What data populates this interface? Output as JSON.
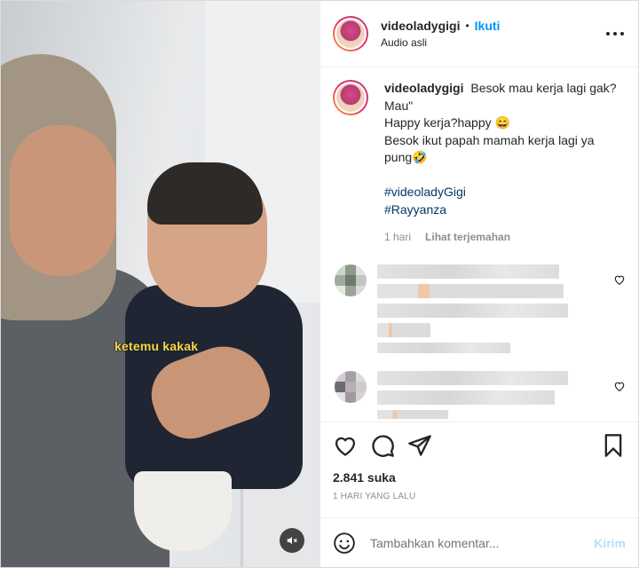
{
  "post": {
    "username": "videoladygigi",
    "separator": "•",
    "follow_label": "Ikuti",
    "audio_label": "Audio asli",
    "more_label": "•••"
  },
  "media": {
    "overlay_caption": "ketemu kakak",
    "sound_icon": "speaker-mute-icon"
  },
  "caption": {
    "username": "videoladygigi",
    "line1": "Besok mau kerja lagi gak? Mau\"",
    "line2": "Happy kerja?happy 😄",
    "line3": "Besok ikut papah mamah kerja lagi ya pung🤣",
    "hashtag1": "#videoladyGigi",
    "hashtag2": "#Rayyanza",
    "time": "1 hari",
    "translate": "Lihat terjemahan"
  },
  "actions": {
    "likes": "2.841 suka",
    "timestamp": "1 HARI YANG LALU"
  },
  "comment_box": {
    "placeholder": "Tambahkan komentar...",
    "send_label": "Kirim"
  },
  "colors": {
    "link_blue": "#0095f6",
    "hashtag_blue": "#00376b",
    "send_disabled": "#b2dffc",
    "caption_yellow": "#f3d64a"
  }
}
